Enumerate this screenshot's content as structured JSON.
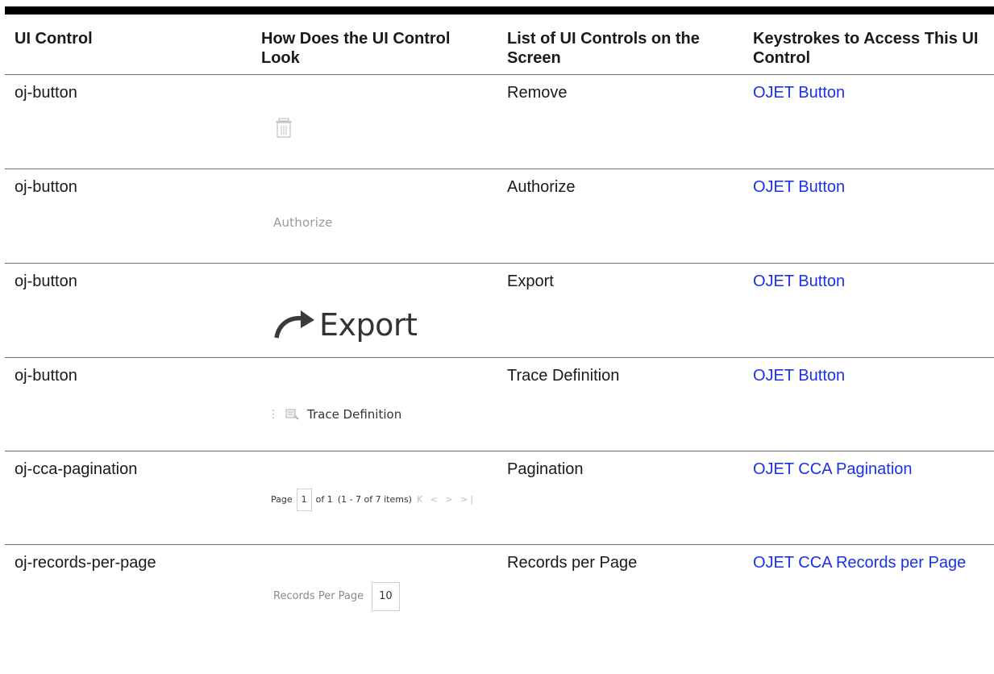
{
  "table": {
    "headers": [
      "UI Control",
      "How Does the UI Control Look",
      "List of UI Controls on the Screen",
      "Keystrokes to Access This UI Control"
    ],
    "rows": [
      {
        "control": "oj-button",
        "preview": {
          "icon": "trash-icon"
        },
        "screen_name": "Remove",
        "keystroke_link": "OJET Button"
      },
      {
        "control": "oj-button",
        "preview": {
          "text": "Authorize"
        },
        "screen_name": "Authorize",
        "keystroke_link": "OJET Button"
      },
      {
        "control": "oj-button",
        "preview": {
          "icon": "export-arrow-icon",
          "text": "Export"
        },
        "screen_name": "Export",
        "keystroke_link": "OJET Button"
      },
      {
        "control": "oj-button",
        "preview": {
          "icon": "trace-definition-icon",
          "text": "Trace Definition"
        },
        "screen_name": "Trace Definition",
        "keystroke_link": "OJET Button"
      },
      {
        "control": "oj-cca-pagination",
        "preview": {
          "page_label": "Page",
          "page_value": "1",
          "of_label": "of 1",
          "items_label": "(1 - 7 of  7  items)",
          "nav_glyphs": "K < > >|"
        },
        "screen_name": "Pagination",
        "keystroke_link": "OJET CCA Pagination"
      },
      {
        "control": "oj-records-per-page",
        "preview": {
          "label": "Records Per Page",
          "value": "10"
        },
        "screen_name": "Records per Page",
        "keystroke_link": "OJET CCA Records per Page"
      }
    ]
  },
  "colors": {
    "link": "#1a31e8",
    "rule": "#000000",
    "row_border": "#6b6b6b"
  }
}
